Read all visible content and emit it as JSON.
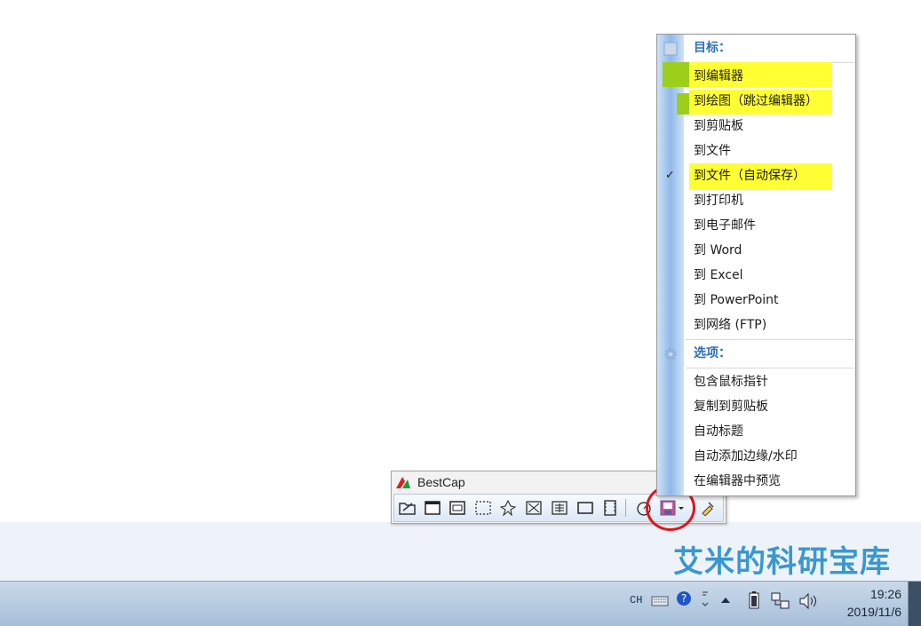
{
  "bestcap": {
    "title": "BestCap",
    "toolbar_icons": [
      "open-icon",
      "fullscreen-icon",
      "window-icon",
      "region-icon",
      "freehand-icon",
      "fixed-region-icon",
      "scroll-icon",
      "object-icon",
      "video-icon",
      "timer-icon",
      "output-target-icon",
      "settings-icon"
    ]
  },
  "menu": {
    "target_header": "目标：",
    "items": [
      {
        "label": "到编辑器",
        "checked": false,
        "highlighted": true
      },
      {
        "label": "到绘图（跳过编辑器）",
        "checked": false,
        "highlighted": true
      },
      {
        "label": "到剪贴板",
        "checked": false,
        "highlighted": false
      },
      {
        "label": "到文件",
        "checked": false,
        "highlighted": false
      },
      {
        "label": "到文件（自动保存）",
        "checked": true,
        "highlighted": true
      },
      {
        "label": "到打印机",
        "checked": false,
        "highlighted": false
      },
      {
        "label": "到电子邮件",
        "checked": false,
        "highlighted": false
      },
      {
        "label": "到 Word",
        "checked": false,
        "highlighted": false
      },
      {
        "label": "到 Excel",
        "checked": false,
        "highlighted": false
      },
      {
        "label": "到 PowerPoint",
        "checked": false,
        "highlighted": false
      },
      {
        "label": "到网络 (FTP)",
        "checked": false,
        "highlighted": false
      }
    ],
    "options_header": "选项：",
    "options": [
      {
        "label": "包含鼠标指针"
      },
      {
        "label": "复制到剪贴板"
      },
      {
        "label": "自动标题"
      },
      {
        "label": "自动添加边缘/水印"
      },
      {
        "label": "在编辑器中预览"
      }
    ],
    "check_mark": "✓"
  },
  "watermark": "艾米的科研宝库",
  "taskbar": {
    "language": "CH",
    "time": "19:26",
    "date": "2019/11/6"
  },
  "colors": {
    "highlight": "#ffff33",
    "accent": "#2f6fb6",
    "annotation_circle": "#e3121b"
  }
}
